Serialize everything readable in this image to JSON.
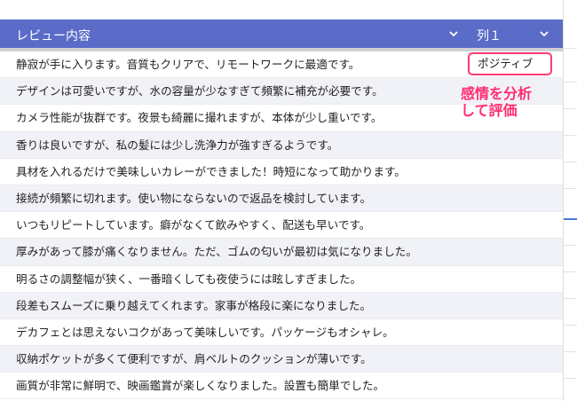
{
  "header": {
    "column1_label": "レビュー内容",
    "column2_label": "列１"
  },
  "rows": [
    {
      "review": "静寂が手に入ります。音質もクリアで、リモートワークに最適です。",
      "result": "ポジティブ"
    },
    {
      "review": "デザインは可愛いですが、水の容量が少なすぎて頻繁に補充が必要です。"
    },
    {
      "review": "カメラ性能が抜群です。夜景も綺麗に撮れますが、本体が少し重いです。"
    },
    {
      "review": "香りは良いですが、私の髪には少し洗浄力が強すぎるようです。"
    },
    {
      "review": "具材を入れるだけで美味しいカレーができました！時短になって助かります。"
    },
    {
      "review": "接続が頻繁に切れます。使い物にならないので返品を検討しています。"
    },
    {
      "review": "いつもリピートしています。癖がなくて飲みやすく、配送も早いです。"
    },
    {
      "review": "厚みがあって膝が痛くなりません。ただ、ゴムの匂いが最初は気になりました。"
    },
    {
      "review": "明るさの調整幅が狭く、一番暗くしても夜使うには眩しすぎました。"
    },
    {
      "review": "段差もスムーズに乗り越えてくれます。家事が格段に楽になりました。"
    },
    {
      "review": "デカフェとは思えないコクがあって美味しいです。パッケージもオシャレ。"
    },
    {
      "review": "収納ポケットが多くて便利ですが、肩ベルトのクッションが薄いです。"
    },
    {
      "review": "画質が非常に鮮明で、映画鑑賞が楽しくなりました。設置も簡単でした。"
    }
  ],
  "annotation": {
    "line1": "感情を分析",
    "line2": "して評価"
  },
  "colors": {
    "header_bg": "#5b6bc8",
    "highlight": "#ff3a73",
    "annotation_text": "#ff2d6f"
  }
}
